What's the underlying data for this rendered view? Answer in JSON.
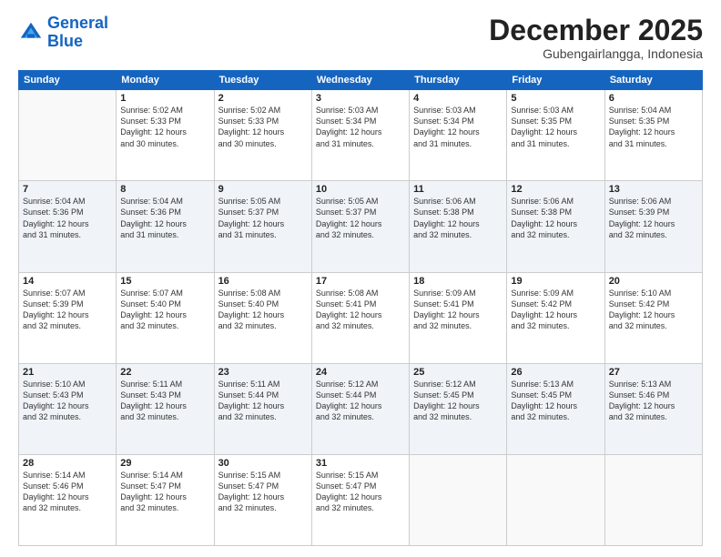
{
  "logo": {
    "line1": "General",
    "line2": "Blue"
  },
  "header": {
    "month": "December 2025",
    "location": "Gubengairlangga, Indonesia"
  },
  "weekdays": [
    "Sunday",
    "Monday",
    "Tuesday",
    "Wednesday",
    "Thursday",
    "Friday",
    "Saturday"
  ],
  "weeks": [
    [
      {
        "day": "",
        "sunrise": "",
        "sunset": "",
        "daylight": ""
      },
      {
        "day": "1",
        "sunrise": "Sunrise: 5:02 AM",
        "sunset": "Sunset: 5:33 PM",
        "daylight": "Daylight: 12 hours and 30 minutes."
      },
      {
        "day": "2",
        "sunrise": "Sunrise: 5:02 AM",
        "sunset": "Sunset: 5:33 PM",
        "daylight": "Daylight: 12 hours and 30 minutes."
      },
      {
        "day": "3",
        "sunrise": "Sunrise: 5:03 AM",
        "sunset": "Sunset: 5:34 PM",
        "daylight": "Daylight: 12 hours and 31 minutes."
      },
      {
        "day": "4",
        "sunrise": "Sunrise: 5:03 AM",
        "sunset": "Sunset: 5:34 PM",
        "daylight": "Daylight: 12 hours and 31 minutes."
      },
      {
        "day": "5",
        "sunrise": "Sunrise: 5:03 AM",
        "sunset": "Sunset: 5:35 PM",
        "daylight": "Daylight: 12 hours and 31 minutes."
      },
      {
        "day": "6",
        "sunrise": "Sunrise: 5:04 AM",
        "sunset": "Sunset: 5:35 PM",
        "daylight": "Daylight: 12 hours and 31 minutes."
      }
    ],
    [
      {
        "day": "7",
        "sunrise": "Sunrise: 5:04 AM",
        "sunset": "Sunset: 5:36 PM",
        "daylight": "Daylight: 12 hours and 31 minutes."
      },
      {
        "day": "8",
        "sunrise": "Sunrise: 5:04 AM",
        "sunset": "Sunset: 5:36 PM",
        "daylight": "Daylight: 12 hours and 31 minutes."
      },
      {
        "day": "9",
        "sunrise": "Sunrise: 5:05 AM",
        "sunset": "Sunset: 5:37 PM",
        "daylight": "Daylight: 12 hours and 31 minutes."
      },
      {
        "day": "10",
        "sunrise": "Sunrise: 5:05 AM",
        "sunset": "Sunset: 5:37 PM",
        "daylight": "Daylight: 12 hours and 32 minutes."
      },
      {
        "day": "11",
        "sunrise": "Sunrise: 5:06 AM",
        "sunset": "Sunset: 5:38 PM",
        "daylight": "Daylight: 12 hours and 32 minutes."
      },
      {
        "day": "12",
        "sunrise": "Sunrise: 5:06 AM",
        "sunset": "Sunset: 5:38 PM",
        "daylight": "Daylight: 12 hours and 32 minutes."
      },
      {
        "day": "13",
        "sunrise": "Sunrise: 5:06 AM",
        "sunset": "Sunset: 5:39 PM",
        "daylight": "Daylight: 12 hours and 32 minutes."
      }
    ],
    [
      {
        "day": "14",
        "sunrise": "Sunrise: 5:07 AM",
        "sunset": "Sunset: 5:39 PM",
        "daylight": "Daylight: 12 hours and 32 minutes."
      },
      {
        "day": "15",
        "sunrise": "Sunrise: 5:07 AM",
        "sunset": "Sunset: 5:40 PM",
        "daylight": "Daylight: 12 hours and 32 minutes."
      },
      {
        "day": "16",
        "sunrise": "Sunrise: 5:08 AM",
        "sunset": "Sunset: 5:40 PM",
        "daylight": "Daylight: 12 hours and 32 minutes."
      },
      {
        "day": "17",
        "sunrise": "Sunrise: 5:08 AM",
        "sunset": "Sunset: 5:41 PM",
        "daylight": "Daylight: 12 hours and 32 minutes."
      },
      {
        "day": "18",
        "sunrise": "Sunrise: 5:09 AM",
        "sunset": "Sunset: 5:41 PM",
        "daylight": "Daylight: 12 hours and 32 minutes."
      },
      {
        "day": "19",
        "sunrise": "Sunrise: 5:09 AM",
        "sunset": "Sunset: 5:42 PM",
        "daylight": "Daylight: 12 hours and 32 minutes."
      },
      {
        "day": "20",
        "sunrise": "Sunrise: 5:10 AM",
        "sunset": "Sunset: 5:42 PM",
        "daylight": "Daylight: 12 hours and 32 minutes."
      }
    ],
    [
      {
        "day": "21",
        "sunrise": "Sunrise: 5:10 AM",
        "sunset": "Sunset: 5:43 PM",
        "daylight": "Daylight: 12 hours and 32 minutes."
      },
      {
        "day": "22",
        "sunrise": "Sunrise: 5:11 AM",
        "sunset": "Sunset: 5:43 PM",
        "daylight": "Daylight: 12 hours and 32 minutes."
      },
      {
        "day": "23",
        "sunrise": "Sunrise: 5:11 AM",
        "sunset": "Sunset: 5:44 PM",
        "daylight": "Daylight: 12 hours and 32 minutes."
      },
      {
        "day": "24",
        "sunrise": "Sunrise: 5:12 AM",
        "sunset": "Sunset: 5:44 PM",
        "daylight": "Daylight: 12 hours and 32 minutes."
      },
      {
        "day": "25",
        "sunrise": "Sunrise: 5:12 AM",
        "sunset": "Sunset: 5:45 PM",
        "daylight": "Daylight: 12 hours and 32 minutes."
      },
      {
        "day": "26",
        "sunrise": "Sunrise: 5:13 AM",
        "sunset": "Sunset: 5:45 PM",
        "daylight": "Daylight: 12 hours and 32 minutes."
      },
      {
        "day": "27",
        "sunrise": "Sunrise: 5:13 AM",
        "sunset": "Sunset: 5:46 PM",
        "daylight": "Daylight: 12 hours and 32 minutes."
      }
    ],
    [
      {
        "day": "28",
        "sunrise": "Sunrise: 5:14 AM",
        "sunset": "Sunset: 5:46 PM",
        "daylight": "Daylight: 12 hours and 32 minutes."
      },
      {
        "day": "29",
        "sunrise": "Sunrise: 5:14 AM",
        "sunset": "Sunset: 5:47 PM",
        "daylight": "Daylight: 12 hours and 32 minutes."
      },
      {
        "day": "30",
        "sunrise": "Sunrise: 5:15 AM",
        "sunset": "Sunset: 5:47 PM",
        "daylight": "Daylight: 12 hours and 32 minutes."
      },
      {
        "day": "31",
        "sunrise": "Sunrise: 5:15 AM",
        "sunset": "Sunset: 5:47 PM",
        "daylight": "Daylight: 12 hours and 32 minutes."
      },
      {
        "day": "",
        "sunrise": "",
        "sunset": "",
        "daylight": ""
      },
      {
        "day": "",
        "sunrise": "",
        "sunset": "",
        "daylight": ""
      },
      {
        "day": "",
        "sunrise": "",
        "sunset": "",
        "daylight": ""
      }
    ]
  ]
}
